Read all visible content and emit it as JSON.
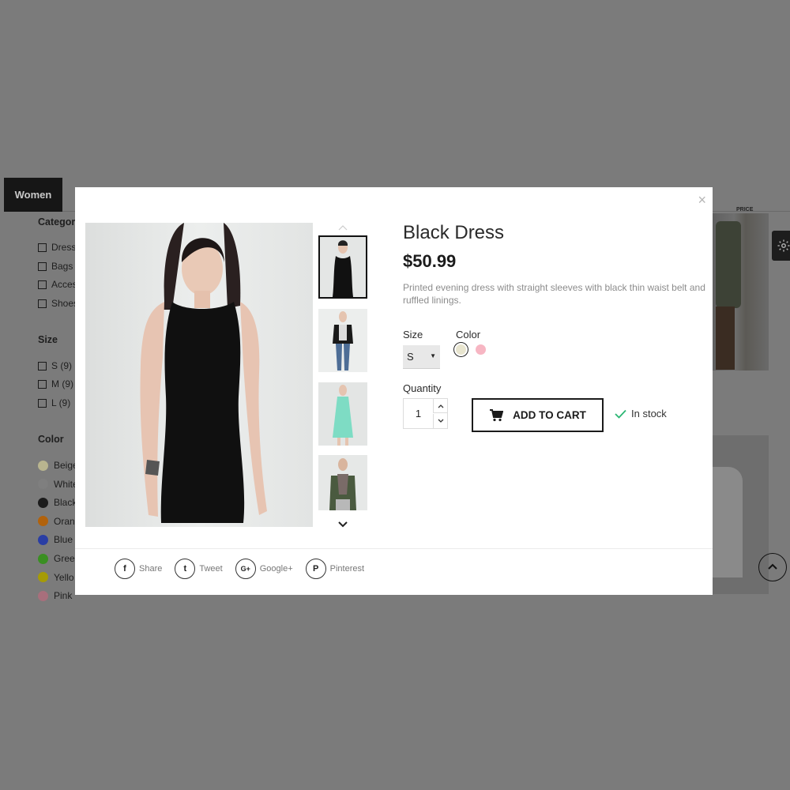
{
  "background": {
    "tab_label": "Women",
    "categories_heading": "Categori",
    "categories": [
      "Dress",
      "Bags",
      "Acces",
      "Shoes"
    ],
    "size_heading": "Size",
    "sizes": [
      "S (9)",
      "M (9)",
      "L (9)"
    ],
    "color_heading": "Color",
    "colors": [
      {
        "name": "Beige",
        "hex": "#b9b58f"
      },
      {
        "name": "White",
        "hex": "#7f7f7f"
      },
      {
        "name": "Black",
        "hex": "#1c1c1c"
      },
      {
        "name": "Oran",
        "hex": "#b1620c"
      },
      {
        "name": "Blue",
        "hex": "#2a3ea4"
      },
      {
        "name": "Gree",
        "hex": "#3a8f22"
      },
      {
        "name": "Yello",
        "hex": "#a69b06"
      },
      {
        "name": "Pink",
        "hex": "#a86f7c"
      }
    ],
    "price_label": "PRICE"
  },
  "modal": {
    "close": "×",
    "product": {
      "title": "Black Dress",
      "price": "$50.99",
      "description": "Printed evening dress with straight sleeves with black thin waist belt and ruffled linings."
    },
    "size_label": "Size",
    "size_selected": "S",
    "color_label": "Color",
    "color_swatches": [
      {
        "name": "beige",
        "hex": "#e8e5cf",
        "selected": true
      },
      {
        "name": "pink",
        "hex": "#f7b6c3",
        "selected": false
      }
    ],
    "quantity_label": "Quantity",
    "quantity": "1",
    "add_to_cart": "ADD TO CART",
    "stock_status": "In stock",
    "share": [
      {
        "label": "Share",
        "icon": "facebook-icon",
        "glyph": "f"
      },
      {
        "label": "Tweet",
        "icon": "twitter-icon",
        "glyph": "t"
      },
      {
        "label": "Google+",
        "icon": "google-plus-icon",
        "glyph": "G+"
      },
      {
        "label": "Pinterest",
        "icon": "pinterest-icon",
        "glyph": "P"
      }
    ]
  },
  "colors": {
    "overlay": "#7b7b7b",
    "accent_check": "#2bb673",
    "button_border": "#1b1b1b"
  }
}
